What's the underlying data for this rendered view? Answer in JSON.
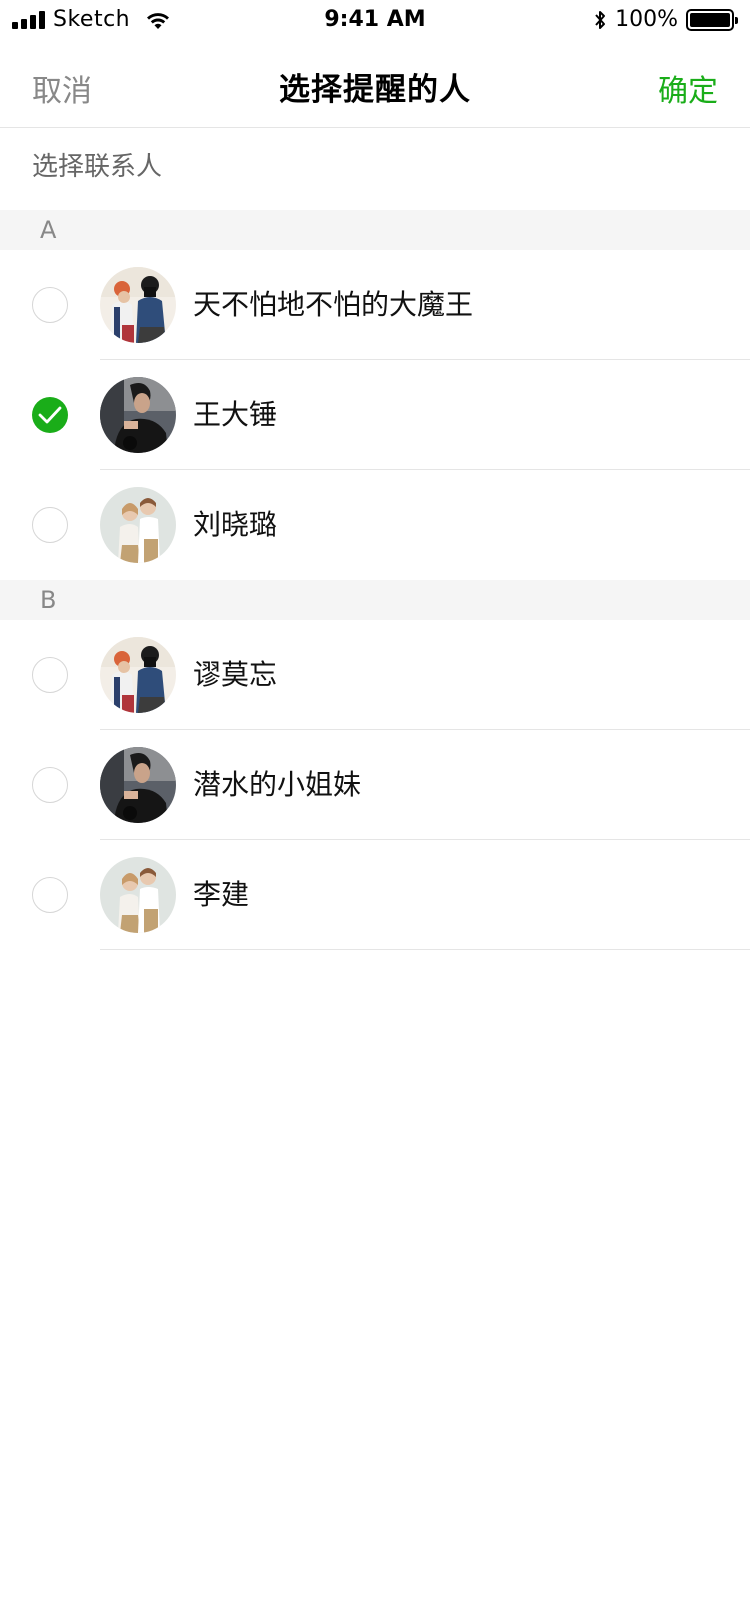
{
  "status_bar": {
    "carrier": "Sketch",
    "time": "9:41 AM",
    "battery": "100%",
    "icons": [
      "signal-icon",
      "wifi-icon",
      "bluetooth-icon",
      "battery-icon"
    ]
  },
  "nav": {
    "cancel": "取消",
    "title": "选择提醒的人",
    "confirm": "确定"
  },
  "search": {
    "placeholder": "选择联系人"
  },
  "sections": [
    {
      "letter": "A",
      "contacts": [
        {
          "name": "天不怕地不怕的大魔王",
          "selected": false,
          "avatar": "couple-photo-avatar"
        },
        {
          "name": "王大锤",
          "selected": true,
          "avatar": "man-portrait-avatar"
        },
        {
          "name": "刘晓璐",
          "selected": false,
          "avatar": "couple-illustration-avatar"
        }
      ]
    },
    {
      "letter": "B",
      "contacts": [
        {
          "name": "谬莫忘",
          "selected": false,
          "avatar": "couple-photo-avatar"
        },
        {
          "name": "潜水的小姐妹",
          "selected": false,
          "avatar": "man-portrait-avatar"
        },
        {
          "name": "李建",
          "selected": false,
          "avatar": "couple-illustration-avatar"
        }
      ]
    }
  ],
  "colors": {
    "accent": "#1aad19",
    "muted_text": "#888888",
    "divider": "#e5e5e5",
    "section_bg": "#f5f5f5"
  }
}
